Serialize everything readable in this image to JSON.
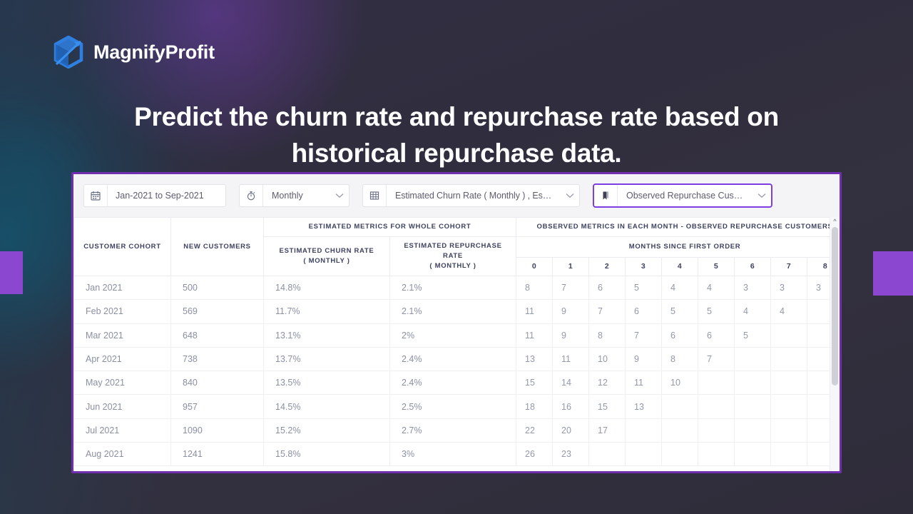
{
  "brand": {
    "name": "MagnifyProfit",
    "logo_icon": "cube-arrow-logo-icon",
    "logo_color": "#2f7fe0"
  },
  "headline": "Predict the churn rate and repurchase rate based on historical repurchase data.",
  "accent": {
    "panel_border": "#6f2fae",
    "block": "#8b47cf",
    "focus": "#7b3fe4"
  },
  "toolbar": {
    "date_range": {
      "icon": "calendar-icon",
      "value": "Jan-2021 to Sep-2021"
    },
    "granularity": {
      "icon": "stopwatch-icon",
      "value": "Monthly",
      "caret": "chevron-down-icon"
    },
    "metrics": {
      "icon": "grid-icon",
      "value": "Estimated Churn Rate ( Monthly ) , Estimated R",
      "caret": "chevron-down-icon"
    },
    "observed": {
      "icon": "bookmark-icon",
      "value": "Observed Repurchase Customers",
      "caret": "chevron-down-icon"
    }
  },
  "table": {
    "headers": {
      "cohort": "CUSTOMER COHORT",
      "new_customers": "NEW CUSTOMERS",
      "estimated_group": "ESTIMATED METRICS FOR WHOLE COHORT",
      "estimated_churn": "ESTIMATED CHURN RATE",
      "estimated_churn_sub": "( MONTHLY )",
      "estimated_repurchase": "ESTIMATED REPURCHASE RATE",
      "estimated_repurchase_sub": "( MONTHLY )",
      "observed_group": "OBSERVED METRICS IN EACH MONTH - OBSERVED REPURCHASE CUSTOMERS",
      "months_since": "MONTHS SINCE FIRST ORDER"
    },
    "month_columns": [
      "0",
      "1",
      "2",
      "3",
      "4",
      "5",
      "6",
      "7",
      "8"
    ],
    "rows": [
      {
        "cohort": "Jan 2021",
        "new_customers": "500",
        "churn_rate": "14.8%",
        "repurchase_rate": "2.1%",
        "months": [
          "8",
          "7",
          "6",
          "5",
          "4",
          "4",
          "3",
          "3",
          "3"
        ]
      },
      {
        "cohort": "Feb 2021",
        "new_customers": "569",
        "churn_rate": "11.7%",
        "repurchase_rate": "2.1%",
        "months": [
          "11",
          "9",
          "7",
          "6",
          "5",
          "5",
          "4",
          "4",
          ""
        ]
      },
      {
        "cohort": "Mar 2021",
        "new_customers": "648",
        "churn_rate": "13.1%",
        "repurchase_rate": "2%",
        "months": [
          "11",
          "9",
          "8",
          "7",
          "6",
          "6",
          "5",
          "",
          ""
        ]
      },
      {
        "cohort": "Apr 2021",
        "new_customers": "738",
        "churn_rate": "13.7%",
        "repurchase_rate": "2.4%",
        "months": [
          "13",
          "11",
          "10",
          "9",
          "8",
          "7",
          "",
          "",
          ""
        ]
      },
      {
        "cohort": "May 2021",
        "new_customers": "840",
        "churn_rate": "13.5%",
        "repurchase_rate": "2.4%",
        "months": [
          "15",
          "14",
          "12",
          "11",
          "10",
          "",
          "",
          "",
          ""
        ]
      },
      {
        "cohort": "Jun 2021",
        "new_customers": "957",
        "churn_rate": "14.5%",
        "repurchase_rate": "2.5%",
        "months": [
          "18",
          "16",
          "15",
          "13",
          "",
          "",
          "",
          "",
          ""
        ]
      },
      {
        "cohort": "Jul 2021",
        "new_customers": "1090",
        "churn_rate": "15.2%",
        "repurchase_rate": "2.7%",
        "months": [
          "22",
          "20",
          "17",
          "",
          "",
          "",
          "",
          "",
          ""
        ]
      },
      {
        "cohort": "Aug 2021",
        "new_customers": "1241",
        "churn_rate": "15.8%",
        "repurchase_rate": "3%",
        "months": [
          "26",
          "23",
          "",
          "",
          "",
          "",
          "",
          "",
          ""
        ]
      }
    ]
  },
  "scrollbar": {
    "up_arrow": "chevron-up-icon"
  }
}
